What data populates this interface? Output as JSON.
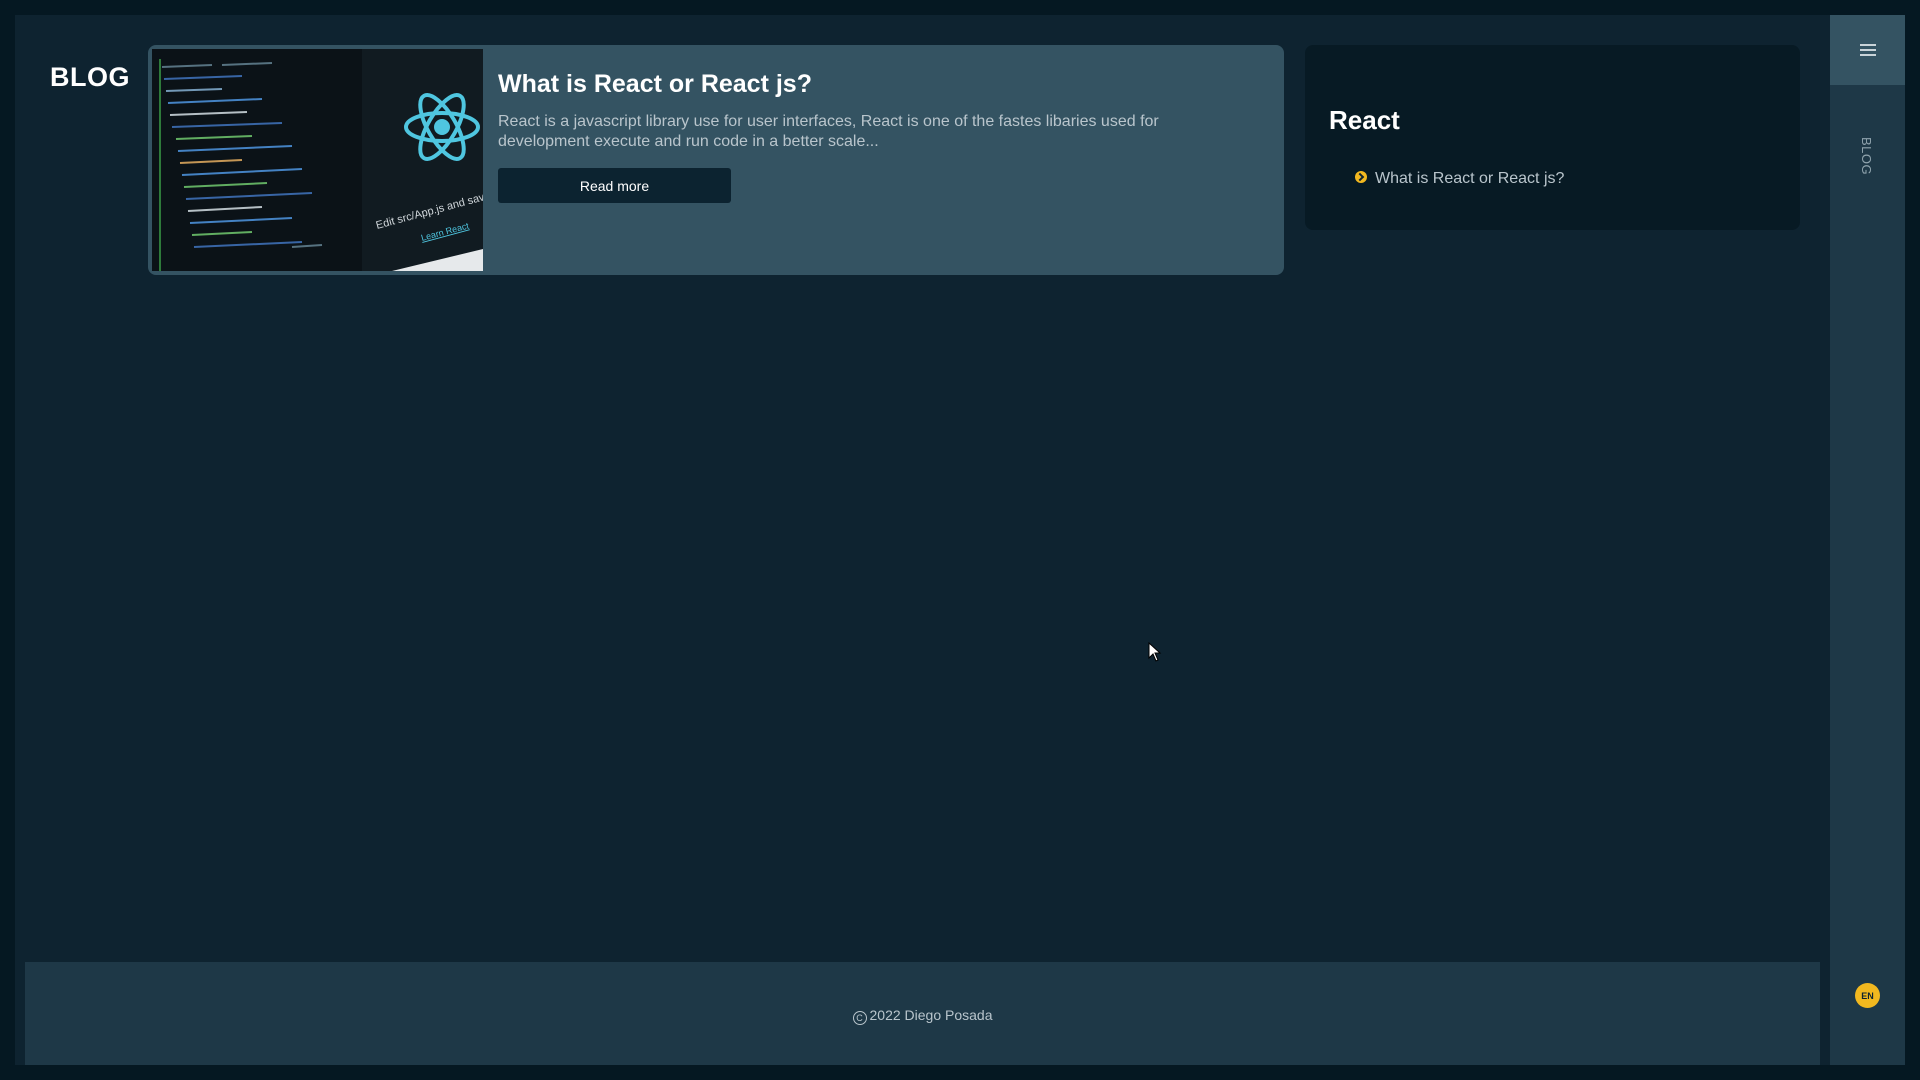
{
  "sidebar_label": "BLOG",
  "page_title": "BLOG",
  "post": {
    "title": "What is React or React js?",
    "excerpt": "React is a javascript library use for user interfaces, React is one of the fastes libaries used for development execute and run code in a better scale...",
    "read_more_label": "Read more",
    "thumbnail_caption": "Edit src/App.js and save to rel",
    "thumbnail_link": "Learn React"
  },
  "category": {
    "title": "React",
    "items": [
      "What is React or React js?"
    ]
  },
  "footer": {
    "copyright_symbol": "C",
    "text": "2022 Diego Posada"
  },
  "language": "EN",
  "colors": {
    "accent": "#f2b81f",
    "card": "#345362",
    "background": "#0e2330"
  }
}
